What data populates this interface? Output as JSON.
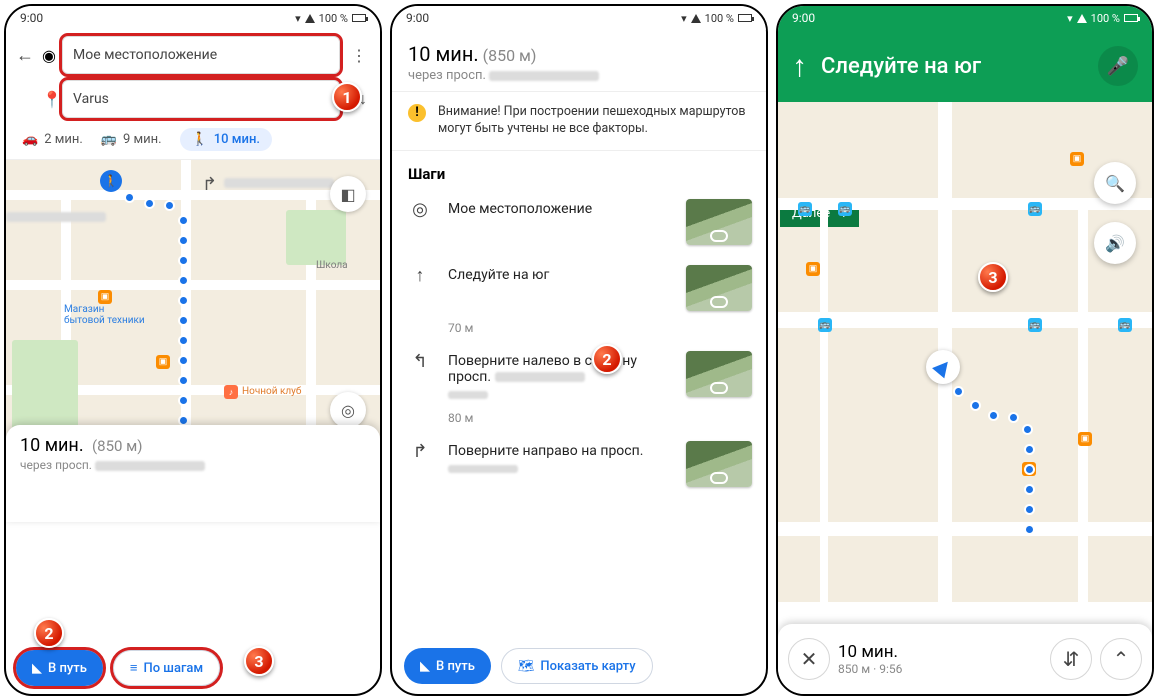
{
  "status": {
    "time": "9:00",
    "battery": "100 %"
  },
  "screen1": {
    "origin": "Мое местоположение",
    "destination": "Varus",
    "modes": {
      "car": "2 мин.",
      "transit": "9 мин.",
      "walk": "10 мин."
    },
    "sheet_time": "10 мин.",
    "sheet_dist": "(850 м)",
    "sheet_via_prefix": "через просп.",
    "btn_start": "В путь",
    "btn_steps": "По шагам",
    "poi_store": "Магазин\nбытовой техники",
    "poi_club": "Ночной клуб",
    "poi_school": "Школа",
    "pin_label": "Varus"
  },
  "screen2": {
    "time": "10 мин.",
    "dist": "(850 м)",
    "via_prefix": "через просп.",
    "warn": "Внимание! При построении пешеходных маршрутов могут быть учтены не все факторы.",
    "steps_title": "Шаги",
    "step1": "Мое местоположение",
    "step2": "Следуйте на юг",
    "step2_dist": "70 м",
    "step3": "Поверните налево в сторону просп.",
    "step3_dist": "80 м",
    "step4": "Поверните направо на просп.",
    "btn_start": "В путь",
    "btn_map": "Показать карту"
  },
  "screen3": {
    "title": "Следуйте на юг",
    "next": "Далее",
    "sheet_time": "10 мин.",
    "sheet_sub": "850 м · 9:56"
  }
}
